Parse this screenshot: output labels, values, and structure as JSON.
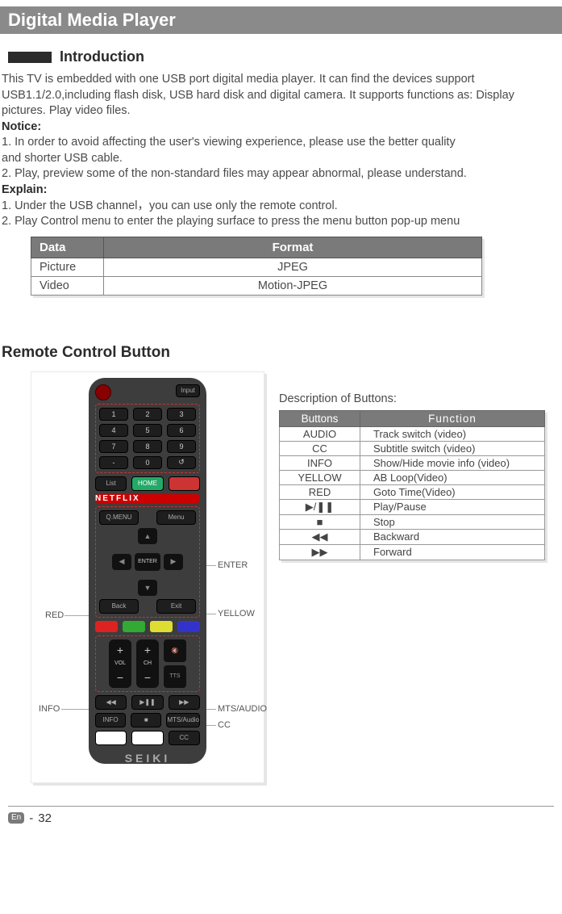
{
  "title": "Digital Media Player",
  "section_intro_label": "Introduction",
  "intro": {
    "p1": "This TV is embedded with one USB port digital media player. It can find the devices support USB1.1/2.0,including flash disk, USB hard disk and digital camera. It supports functions as: Display pictures. Play video files.",
    "notice_label": "Notice:",
    "n1": "1. In order to avoid affecting the user's viewing experience, please use the better quality",
    "n1b": "and shorter USB cable.",
    "n2": "2. Play, preview some of the non-standard files may appear abnormal, please understand.",
    "explain_label": "Explain:",
    "e1": "1. Under the USB channel，you can use only the remote control.",
    "e2": "2. Play Control menu to enter the playing surface to press the menu button pop-up menu"
  },
  "format_table": {
    "h1": "Data",
    "h2": "Format",
    "rows": [
      {
        "c1": "Picture",
        "c2": "JPEG"
      },
      {
        "c1": "Video",
        "c2": "Motion-JPEG"
      }
    ]
  },
  "remote_heading": "Remote Control Button",
  "remote_labels": {
    "enter": "ENTER",
    "yellow": "YELLOW",
    "red": "RED",
    "info": "INFO",
    "mts_audio": "MTS/AUDIO",
    "cc": "CC"
  },
  "remote": {
    "input": "Input",
    "list": "List",
    "home": "HOME",
    "netflix": "NETFLIX",
    "qmenu": "Q.MENU",
    "menu": "Menu",
    "enter": "ENTER",
    "back": "Back",
    "exit": "Exit",
    "vol": "VOL",
    "ch": "CH",
    "tts": "TTS",
    "info": "INFO",
    "mts": "MTS/Audio",
    "cc": "CC",
    "brand": "SEIKI"
  },
  "desc_title": "Description of Buttons:",
  "button_table": {
    "h1": "Buttons",
    "h2": "Function",
    "rows": [
      {
        "b": "AUDIO",
        "f": "Track switch (video)"
      },
      {
        "b": "CC",
        "f": "Subtitle switch (video)"
      },
      {
        "b": "INFO",
        "f": "Show/Hide movie info (video)"
      },
      {
        "b": "YELLOW",
        "f": "AB Loop(Video)"
      },
      {
        "b": "RED",
        "f": "Goto Time(Video)"
      },
      {
        "b": "▶/❚❚",
        "f": "Play/Pause"
      },
      {
        "b": "■",
        "f": "Stop"
      },
      {
        "b": "◀◀",
        "f": "Backward"
      },
      {
        "b": "▶▶",
        "f": "Forward"
      }
    ]
  },
  "footer": {
    "en": "En",
    "dash": "-",
    "page": "32"
  }
}
